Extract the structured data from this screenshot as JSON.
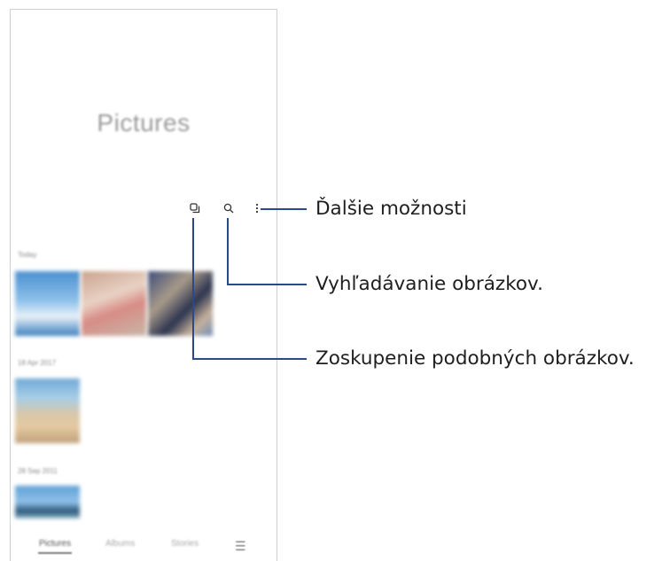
{
  "app": {
    "screen_title": "Pictures",
    "sections": [
      {
        "date": "Today"
      },
      {
        "date": "18 Apr 2017"
      },
      {
        "date": "28 Sep 2011"
      }
    ],
    "toolbar_icons": [
      "group-similar-icon",
      "search-icon",
      "more-options-icon"
    ],
    "bottom_nav": {
      "tabs": [
        "Pictures",
        "Albums",
        "Stories"
      ],
      "active_tab": "Pictures",
      "menu_icon": "hamburger-menu-icon"
    }
  },
  "callouts": {
    "more_options": "Ďalšie možnosti",
    "search": "Vyhľadávanie obrázkov.",
    "group_similar": "Zoskupenie podobných obrázkov."
  },
  "colors": {
    "callout_line": "#2b4a8b",
    "phone_border": "#cfcfcf"
  }
}
